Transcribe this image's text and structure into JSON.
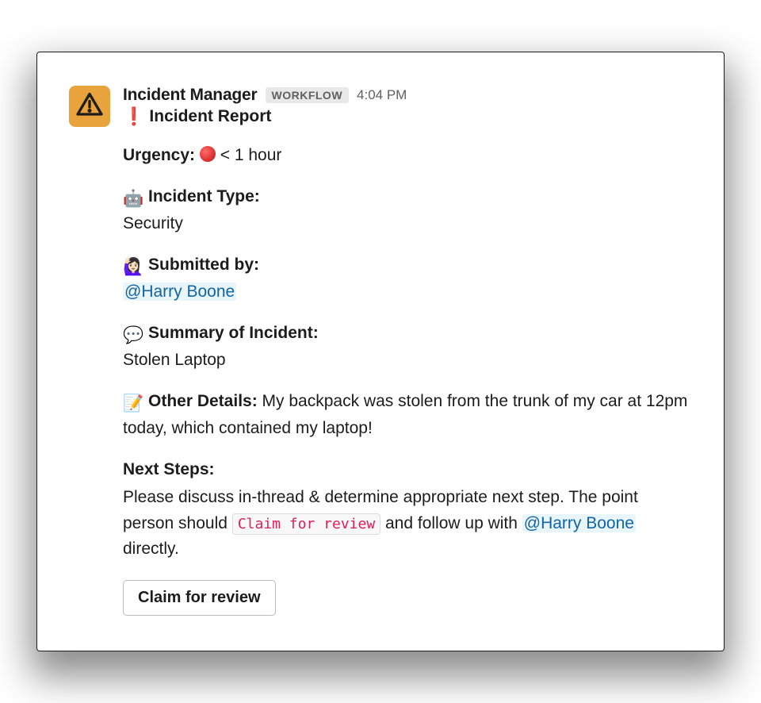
{
  "message": {
    "app_name": "Incident Manager",
    "badge": "WORKFLOW",
    "timestamp": "4:04 PM",
    "title_emoji": "❗",
    "title": "Incident Report"
  },
  "fields": {
    "urgency": {
      "label": "Urgency:",
      "value": "< 1 hour"
    },
    "incident_type": {
      "emoji": "🤖",
      "label": "Incident Type:",
      "value": "Security"
    },
    "submitted_by": {
      "emoji": "🙋🏻‍♀️",
      "label": "Submitted by:",
      "mention": "@Harry Boone"
    },
    "summary": {
      "emoji": "💬",
      "label": "Summary of Incident:",
      "value": "Stolen Laptop"
    },
    "other_details": {
      "emoji": "📝",
      "label": "Other Details:",
      "value": "My backpack was stolen from the trunk of my car at 12pm today, which contained my laptop!"
    }
  },
  "next_steps": {
    "label": "Next Steps:",
    "text_before": "Please discuss in-thread & determine appropriate next step. The point person should ",
    "code": "Claim for review",
    "text_mid": " and follow up with ",
    "mention": "@Harry Boone",
    "text_after": " directly."
  },
  "button": {
    "label": "Claim for review"
  }
}
